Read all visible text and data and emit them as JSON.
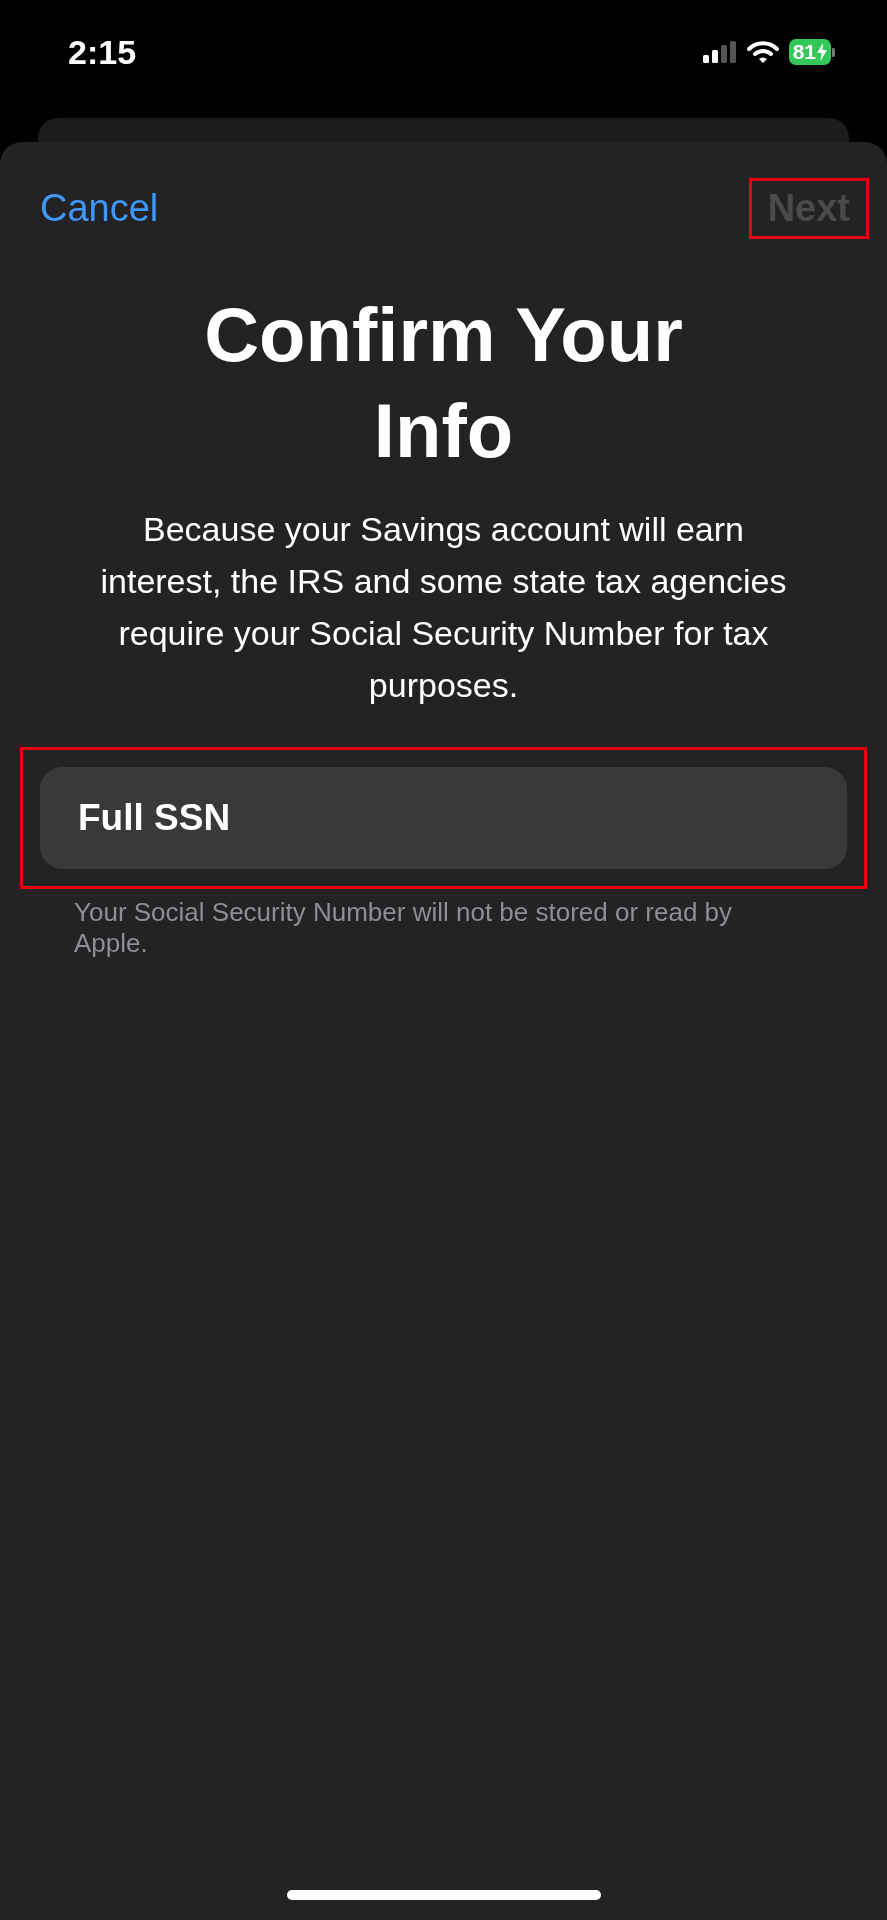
{
  "status_bar": {
    "time": "2:15",
    "battery": "81",
    "charging": true
  },
  "nav": {
    "cancel": "Cancel",
    "next": {
      "label": "Next",
      "disabled": true,
      "highlighted": true
    }
  },
  "title": "Confirm Your Info",
  "description": "Because your Savings account will earn interest, the IRS and some state tax agencies require your Social Security Number for tax purposes.",
  "ssn_field": {
    "placeholder": "Full SSN",
    "highlighted": true
  },
  "footnote": "Your Social Security Number will not be stored or read by Apple."
}
